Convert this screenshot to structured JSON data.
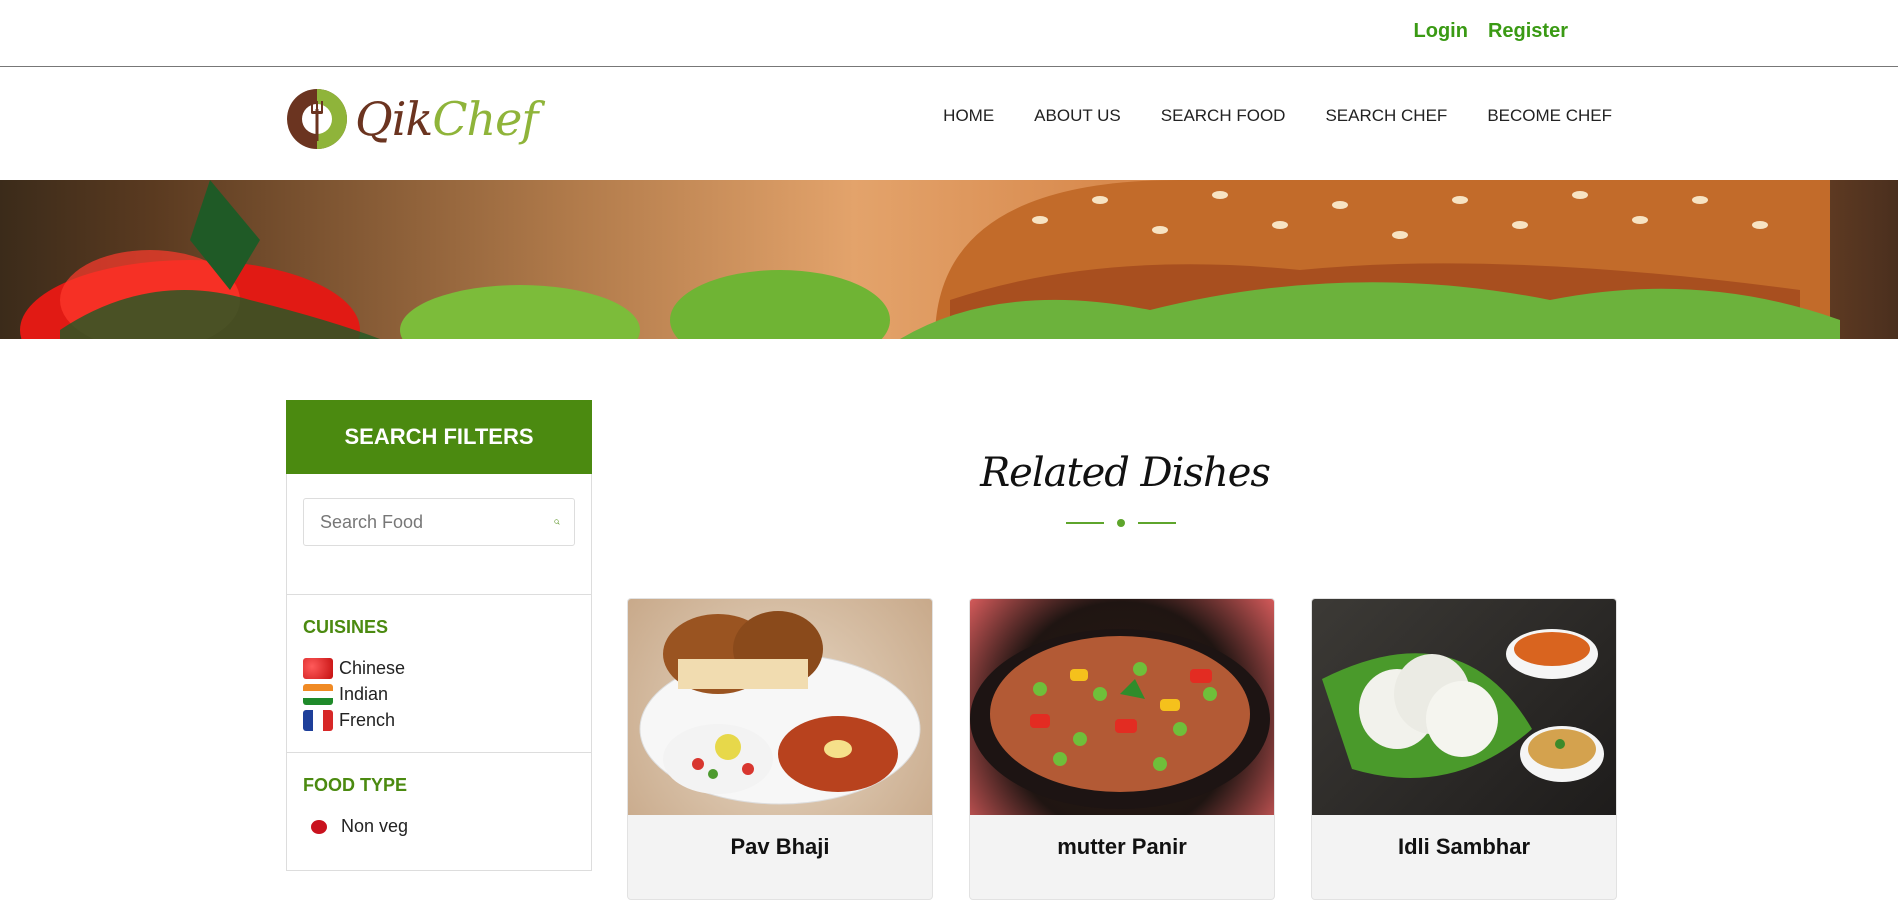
{
  "topbar": {
    "login": "Login",
    "register": "Register"
  },
  "brand": {
    "part1": "Qik",
    "part2": "Chef"
  },
  "menu": [
    {
      "label": "HOME"
    },
    {
      "label": "ABOUT US"
    },
    {
      "label": "SEARCH FOOD"
    },
    {
      "label": "SEARCH CHEF"
    },
    {
      "label": "BECOME CHEF"
    }
  ],
  "sidebar": {
    "title": "SEARCH FILTERS",
    "search_placeholder": "Search Food",
    "cuisines_title": "CUISINES",
    "cuisines": [
      {
        "label": "Chinese",
        "icon": "china-flag-icon"
      },
      {
        "label": "Indian",
        "icon": "india-flag-icon"
      },
      {
        "label": "French",
        "icon": "france-flag-icon"
      }
    ],
    "food_type_title": "FOOD TYPE",
    "food_types": [
      {
        "label": "Non veg",
        "color": "#c9121e"
      }
    ]
  },
  "main": {
    "heading": "Related Dishes",
    "dishes": [
      {
        "title": "Pav Bhaji"
      },
      {
        "title": "mutter Panir"
      },
      {
        "title": "Idli Sambhar"
      }
    ]
  },
  "colors": {
    "accent": "#4b8a10",
    "link": "#3a9a14",
    "brand_dark": "#6b3420",
    "brand_light": "#8fb43a"
  }
}
